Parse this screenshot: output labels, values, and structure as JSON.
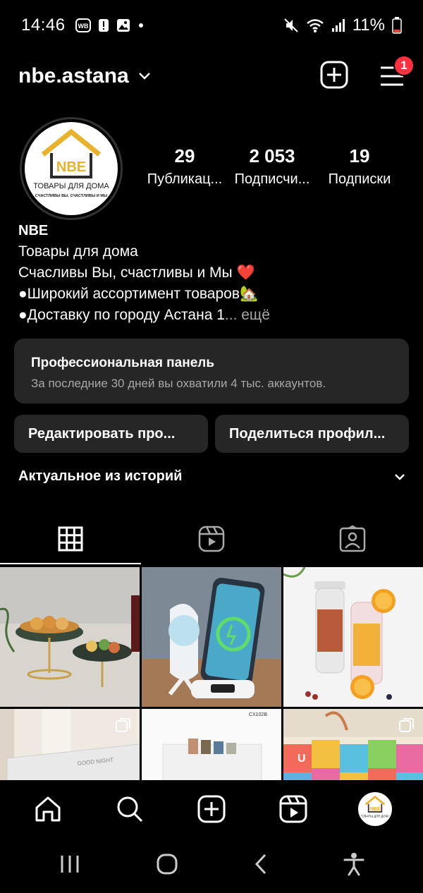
{
  "status_bar": {
    "time": "14:46",
    "battery": "11%",
    "icons_left": [
      "wb-icon",
      "alert-icon",
      "gallery-icon",
      "dot-icon"
    ],
    "icons_right": [
      "mute-icon",
      "wifi-icon",
      "signal-icon",
      "battery-icon"
    ]
  },
  "header": {
    "username": "nbe.astana",
    "notification_count": "1"
  },
  "profile": {
    "avatar_brand": "NBE",
    "avatar_title": "ТОВАРЫ ДЛЯ ДОМА",
    "avatar_slogan": "СЧАСТЛИВЫ ВЫ, СЧАСТЛИВЫ И МЫ",
    "stats": [
      {
        "value": "29",
        "label": "Публикац..."
      },
      {
        "value": "2 053",
        "label": "Подписчи..."
      },
      {
        "value": "19",
        "label": "Подписки"
      }
    ],
    "name": "NBE",
    "bio_lines": [
      "Товары для дома",
      "Счасливы Вы, счастливы и Мы ❤️",
      "●Широкий ассортимент товаров🏡",
      "●Доставку по городу Астана 1"
    ],
    "more": "... ещё"
  },
  "pro_panel": {
    "title": "Профессиональная панель",
    "subtitle": "За последние 30 дней вы охватили 4 тыс. аккаунтов."
  },
  "buttons": {
    "edit": "Редактировать про...",
    "share": "Поделиться профил..."
  },
  "highlights": {
    "label": "Актуальное из историй"
  },
  "tabs": [
    "grid-icon",
    "reels-icon",
    "tagged-icon"
  ],
  "grid_captions": {
    "tile5_label": "CX102B"
  },
  "colors": {
    "background": "#000000",
    "panel": "#262626",
    "badge": "#ff3040",
    "muted": "#a8a8a8"
  }
}
